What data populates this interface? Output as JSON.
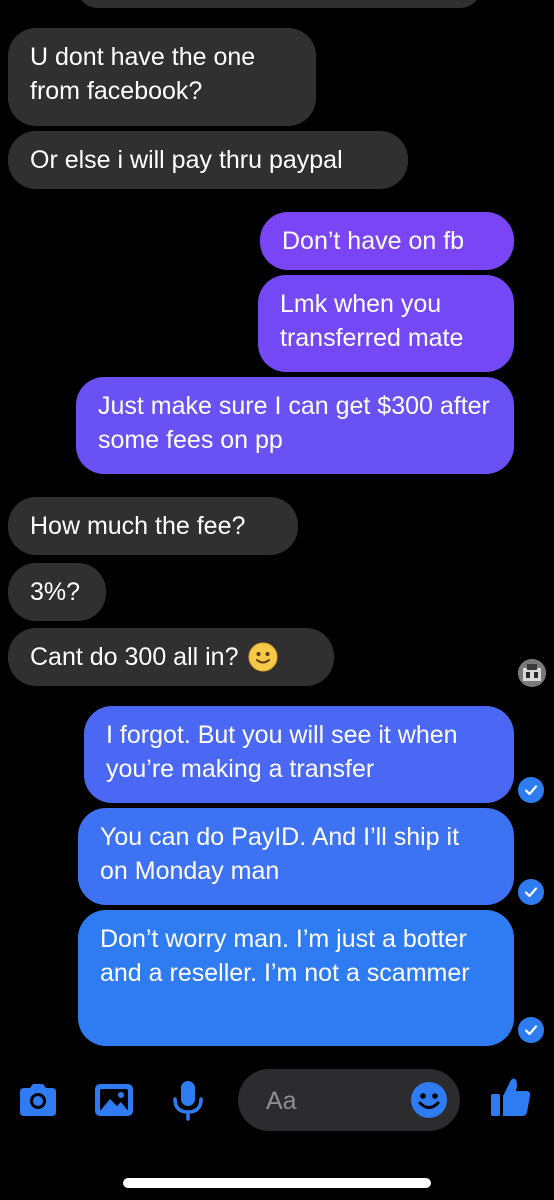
{
  "colors": {
    "background": "#000000",
    "incoming_bubble": "#303030",
    "outgoing_gradient_top": "#7a46f5",
    "outgoing_gradient_bottom": "#2f7cf2",
    "accent_blue": "#2f7cf2"
  },
  "messages": [
    {
      "side": "incoming",
      "text": "U dont have the one from facebook?"
    },
    {
      "side": "incoming",
      "text": "Or else i will pay thru paypal"
    },
    {
      "side": "outgoing",
      "text": "Don’t have on fb"
    },
    {
      "side": "outgoing",
      "text": "Lmk when you transferred mate"
    },
    {
      "side": "outgoing",
      "text": "Just make sure I can get $300 after some fees on pp"
    },
    {
      "side": "incoming",
      "text": "How much the fee?"
    },
    {
      "side": "incoming",
      "text": "3%?"
    },
    {
      "side": "incoming",
      "text": "Cant do 300 all in?",
      "emoji": "slightly-smiling-face"
    },
    {
      "side": "outgoing",
      "text": "I forgot. But you will see it when you’re making a transfer",
      "status": "read"
    },
    {
      "side": "outgoing",
      "text": "You can do PayID. And I’ll ship it on Monday man",
      "status": "read"
    },
    {
      "side": "outgoing",
      "text": "Don’t worry man. I’m just a botter and a reseller. I’m not a scammer",
      "status": "read"
    }
  ],
  "composer": {
    "placeholder": "Aa",
    "icons": [
      "camera-icon",
      "photo-icon",
      "microphone-icon",
      "emoji-icon",
      "thumbs-up-icon"
    ]
  }
}
